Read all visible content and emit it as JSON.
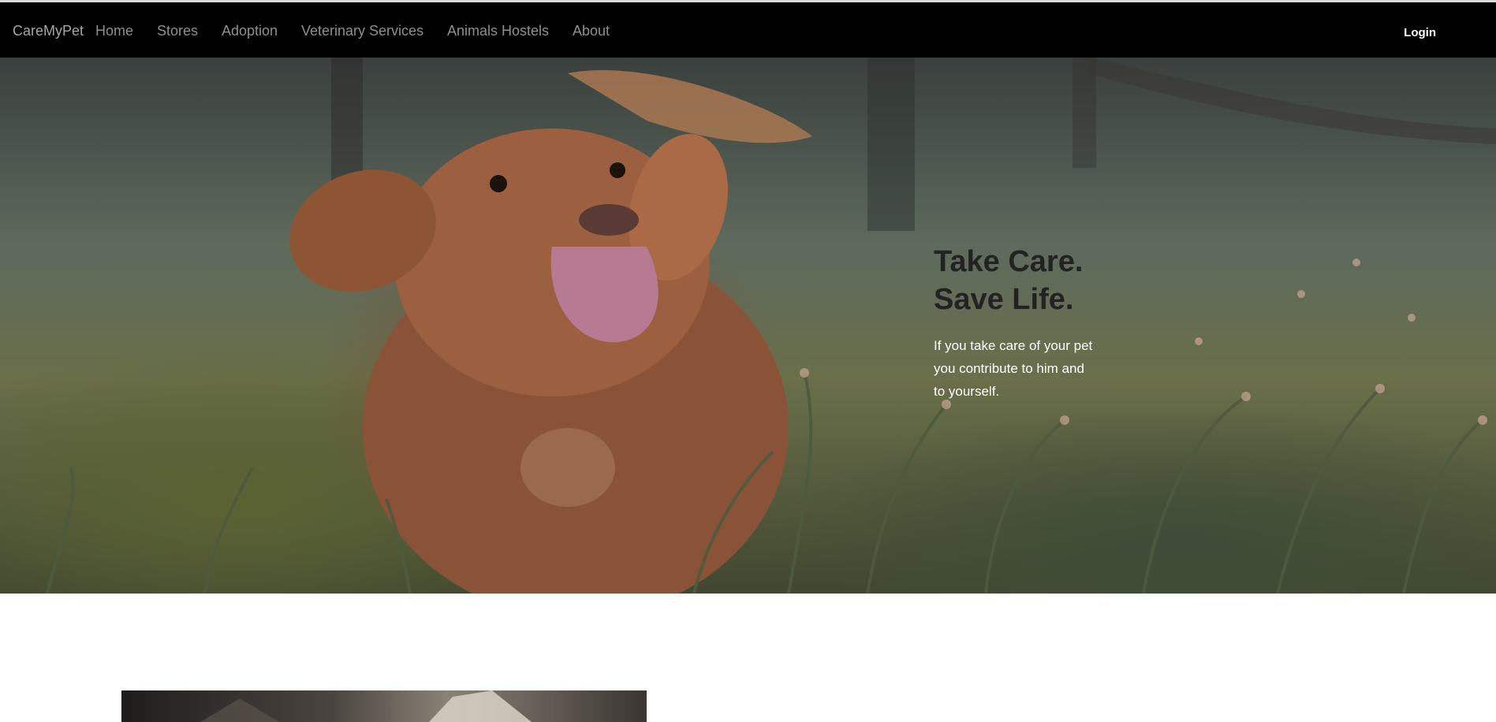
{
  "nav": {
    "brand": "CareMyPet",
    "items": [
      {
        "label": "Home"
      },
      {
        "label": "Stores"
      },
      {
        "label": "Adoption"
      },
      {
        "label": "Veterinary Services"
      },
      {
        "label": "Animals Hostels"
      },
      {
        "label": "About"
      }
    ],
    "login": "Login"
  },
  "hero": {
    "title_lines": [
      "Take Care.",
      "Save Life."
    ],
    "subtitle_lines": [
      "If you take care of your pet",
      "you contribute to him and",
      "to yourself."
    ]
  },
  "colors": {
    "navbar_bg": "#000000",
    "nav_text": "#8f8f8f",
    "login_text": "#ffffff",
    "title_text": "#222222"
  }
}
